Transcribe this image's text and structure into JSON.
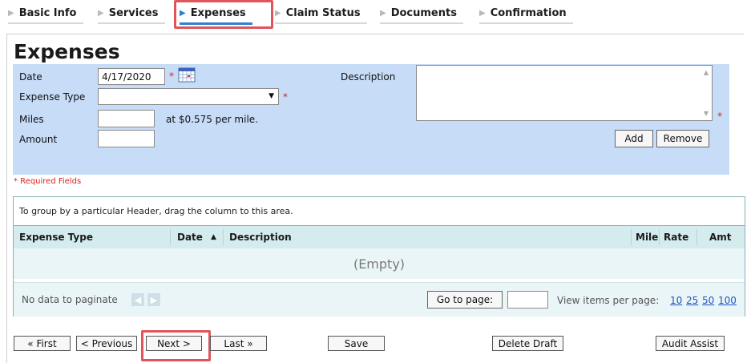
{
  "tabs": [
    {
      "label": "Basic Info"
    },
    {
      "label": "Services"
    },
    {
      "label": "Expenses"
    },
    {
      "label": "Claim Status"
    },
    {
      "label": "Documents"
    },
    {
      "label": "Confirmation"
    }
  ],
  "page_title": "Expenses",
  "form": {
    "date_label": "Date",
    "date_value": "4/17/2020",
    "expense_type_label": "Expense Type",
    "expense_type_value": "",
    "miles_label": "Miles",
    "miles_value": "",
    "miles_rate_text": "at $0.575 per mile.",
    "amount_label": "Amount",
    "amount_value": "",
    "description_label": "Description",
    "description_value": "",
    "required_marker": "*",
    "add_label": "Add",
    "remove_label": "Remove",
    "required_fields_text": "* Required Fields"
  },
  "grid": {
    "group_hint": "To group by a particular Header, drag the column to this area.",
    "columns": [
      "Expense Type",
      "Date",
      "Description",
      "Mile",
      "Rate",
      "Amt"
    ],
    "sort_indicator": "▲",
    "empty_text": "(Empty)",
    "pager": {
      "no_data_text": "No data to paginate",
      "go_to_page_label": "Go to page:",
      "go_to_page_value": "",
      "items_per_page_label": "View items per page:",
      "page_sizes": [
        "10",
        "25",
        "50",
        "100"
      ]
    }
  },
  "nav": {
    "first_label": "« First",
    "previous_label": "< Previous",
    "next_label": "Next >",
    "last_label": "Last »",
    "save_label": "Save",
    "delete_draft_label": "Delete Draft",
    "audit_assist_label": "Audit Assist"
  },
  "colors": {
    "form_bg": "#c6dcf7",
    "grid_header_bg": "#d4ecee",
    "active_tab_accent": "#2f7fd0",
    "highlight_box": "#e0555a",
    "required_red": "#e02020",
    "link_blue": "#1f56c3"
  }
}
